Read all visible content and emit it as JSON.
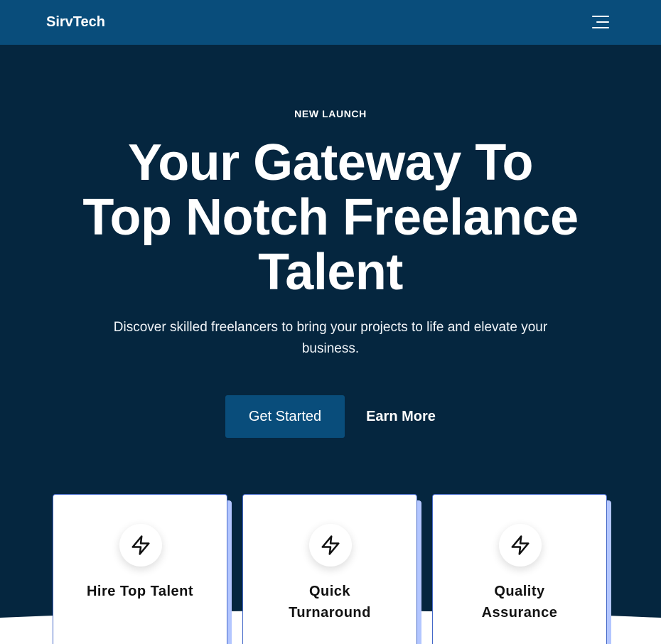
{
  "header": {
    "brand": "SirvTech",
    "menu_icon": "menu-icon"
  },
  "hero": {
    "eyebrow": "NEW LAUNCH",
    "headline": "Your Gateway To Top Notch Freelance Talent",
    "subtext": "Discover skilled freelancers to bring your projects to life and elevate your business.",
    "primary_cta": "Get Started",
    "secondary_cta": "Earn More"
  },
  "features": [
    {
      "title": "Hire Top Talent",
      "icon": "lightning-icon"
    },
    {
      "title": "Quick Turnaround",
      "icon": "lightning-icon"
    },
    {
      "title": "Quality Assurance",
      "icon": "lightning-icon"
    }
  ],
  "colors": {
    "nav_bg": "#094d7b",
    "hero_bg": "#05263f",
    "primary_button": "#094d7b",
    "card_accent": "#b3c6ff",
    "card_border": "#4468c8"
  }
}
